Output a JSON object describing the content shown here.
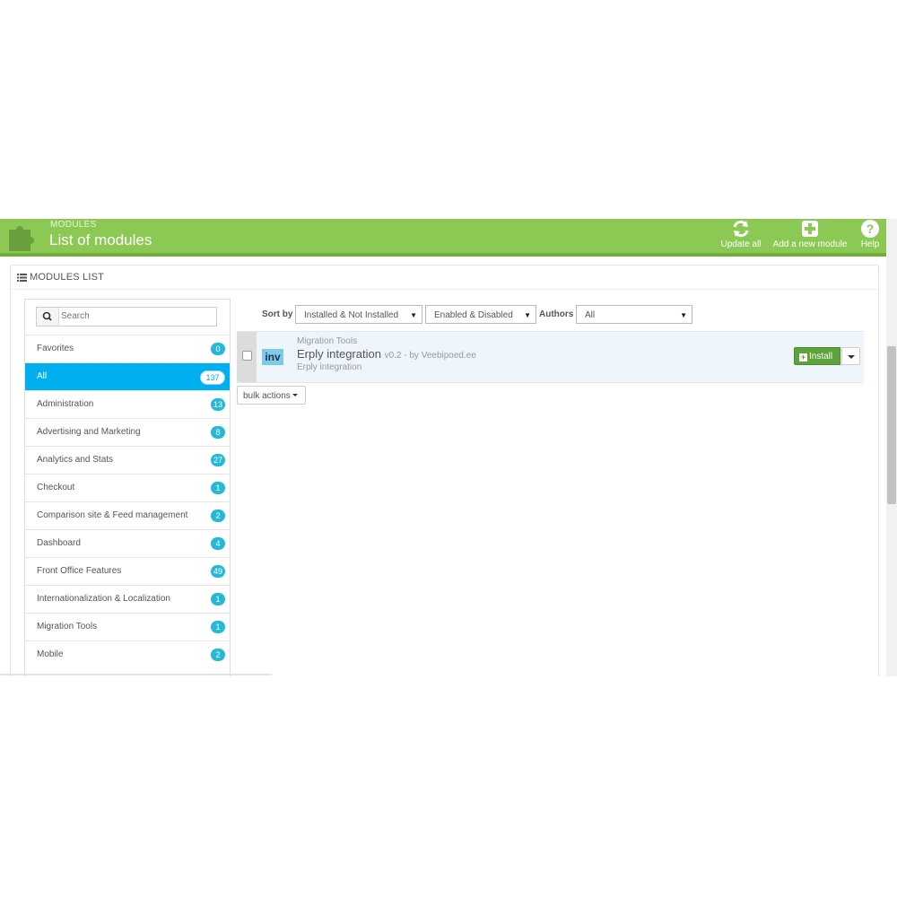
{
  "header": {
    "breadcrumb": "MODULES",
    "title": "List of modules",
    "toolbar": {
      "update_all": "Update all",
      "add_new_module": "Add a new module",
      "help": "Help"
    },
    "colors": {
      "bar": "#8bc954",
      "accent": "#00aff0",
      "badge": "#25b9d7",
      "install": "#5ba33a"
    }
  },
  "panel": {
    "heading": "MODULES LIST"
  },
  "sidebar": {
    "search_placeholder": "Search",
    "categories": [
      {
        "label": "Favorites",
        "count": "0",
        "active": false
      },
      {
        "label": "All",
        "count": "137",
        "active": true
      },
      {
        "label": "Administration",
        "count": "13",
        "active": false
      },
      {
        "label": "Advertising and Marketing",
        "count": "8",
        "active": false
      },
      {
        "label": "Analytics and Stats",
        "count": "27",
        "active": false
      },
      {
        "label": "Checkout",
        "count": "1",
        "active": false
      },
      {
        "label": "Comparison site & Feed management",
        "count": "2",
        "active": false
      },
      {
        "label": "Dashboard",
        "count": "4",
        "active": false
      },
      {
        "label": "Front Office Features",
        "count": "49",
        "active": false
      },
      {
        "label": "Internationalization & Localization",
        "count": "1",
        "active": false
      },
      {
        "label": "Migration Tools",
        "count": "1",
        "active": false
      },
      {
        "label": "Mobile",
        "count": "2",
        "active": false
      }
    ]
  },
  "filters": {
    "sort_by_label": "Sort by",
    "install_filter": "Installed & Not Installed",
    "status_filter": "Enabled & Disabled",
    "authors_label": "Authors",
    "authors_value": "All"
  },
  "module": {
    "category": "Migration Tools",
    "name": "Erply integration",
    "version_author": "v0.2 - by Veebipoed.ee",
    "description": "Erply integration",
    "logo_text": "inv",
    "install_label": "Install"
  },
  "bulk_actions_label": "bulk actions"
}
